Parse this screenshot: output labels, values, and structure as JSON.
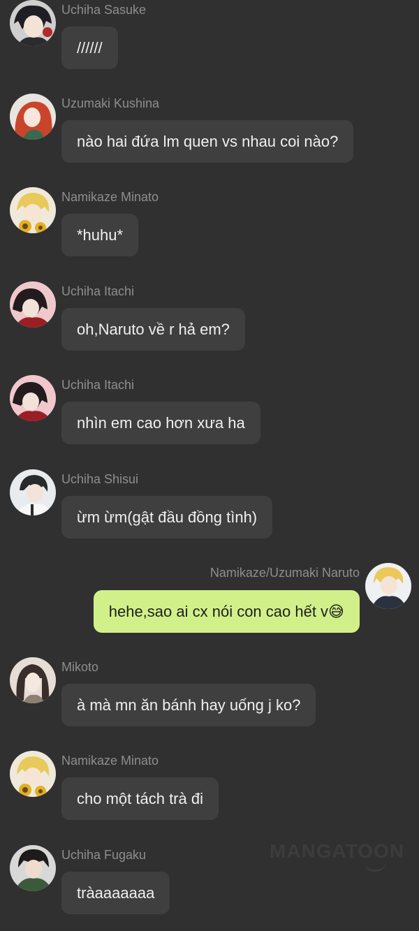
{
  "messages": [
    {
      "name": "Uchiha Sasuke",
      "text": "//////",
      "avatar": "avatar-sasuke-icon"
    },
    {
      "name": "Uzumaki Kushina",
      "text": "nào hai đứa lm quen vs nhau coi nào?",
      "avatar": "avatar-kushina-icon"
    },
    {
      "name": "Namikaze Minato",
      "text": "*huhu*",
      "avatar": "avatar-minato-icon"
    },
    {
      "name": "Uchiha Itachi",
      "text": "oh,Naruto về r hả em?",
      "avatar": "avatar-itachi-icon"
    },
    {
      "name": "Uchiha Itachi",
      "text": "nhìn em cao hơn xưa ha",
      "avatar": "avatar-itachi-icon"
    },
    {
      "name": "Uchiha Shisui",
      "text": "ừm ừm(gật đầu đồng tình)",
      "avatar": "avatar-shisui-icon"
    },
    {
      "name": "Namikaze/Uzumaki Naruto",
      "text": "hehe,sao ai cx nói con cao hết v😅",
      "avatar": "avatar-naruto-icon",
      "self": true
    },
    {
      "name": "Mikoto",
      "text": "à mà mn ăn bánh hay uống j ko?",
      "avatar": "avatar-mikoto-icon"
    },
    {
      "name": "Namikaze Minato",
      "text": "cho một tách trà đi",
      "avatar": "avatar-minato-icon"
    },
    {
      "name": "Uchiha Fugaku",
      "text": "tràaaaaaaa",
      "avatar": "avatar-fugaku-icon"
    }
  ],
  "watermark": "MANGATOON",
  "colors": {
    "background": "#303030",
    "bubble": "#3f3f3f",
    "self_bubble": "#d2f08a",
    "name": "#8e8e8e"
  }
}
